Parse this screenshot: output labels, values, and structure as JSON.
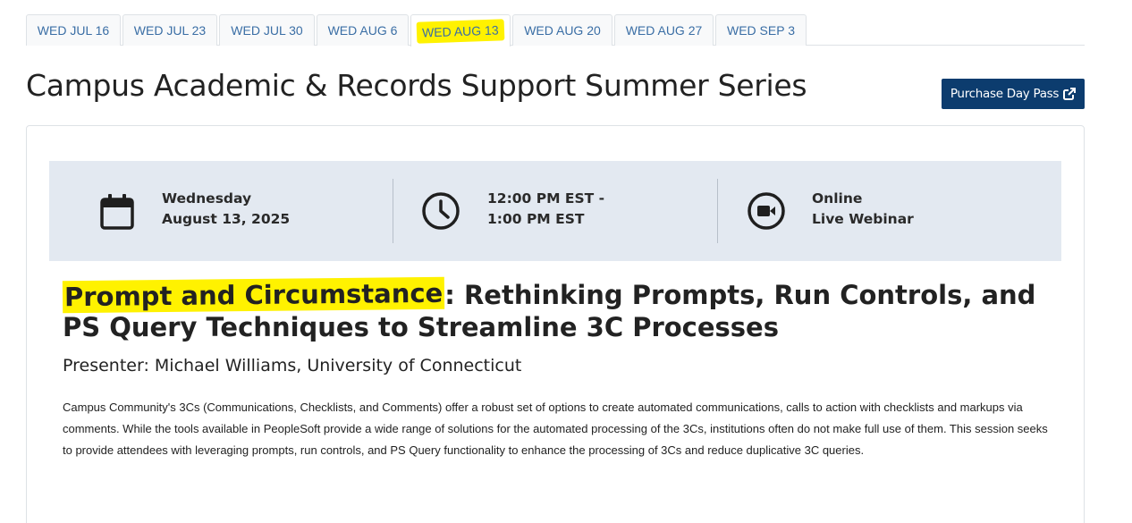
{
  "tabs": [
    {
      "label": "WED JUL 16"
    },
    {
      "label": "WED JUL 23"
    },
    {
      "label": "WED JUL 30"
    },
    {
      "label": "WED AUG 6"
    },
    {
      "label": "WED AUG 13",
      "active": true
    },
    {
      "label": "WED AUG 20"
    },
    {
      "label": "WED AUG 27"
    },
    {
      "label": "WED SEP 3"
    }
  ],
  "page": {
    "title": "Campus Academic & Records Support Summer Series",
    "purchase_label": "Purchase Day Pass",
    "purchase_icon": "external-link-icon"
  },
  "info": {
    "date_line1": "Wednesday",
    "date_line2": "August 13, 2025",
    "time_line1": "12:00 PM EST -",
    "time_line2": "1:00 PM EST",
    "location_line1": "Online",
    "location_line2": "Live Webinar",
    "icons": [
      "calendar-icon",
      "clock-icon",
      "video-camera-icon"
    ]
  },
  "session": {
    "title_highlight": "Prompt and Circumstance",
    "title_rest": ": Rethinking Prompts, Run Controls, and PS Query Techniques to Streamline 3C Processes",
    "presenter": "Presenter: Michael Williams, University of Connecticut",
    "description": "Campus Community's 3Cs (Communications, Checklists, and Comments) offer a robust set of options to create automated communications, calls to action with checklists and markups via comments.  While the tools available in PeopleSoft provide a wide range of solutions for the automated processing of the 3Cs, institutions often do not make full use of them.  This session seeks to provide attendees with leveraging prompts, run controls, and PS Query functionality to enhance the processing of 3Cs and reduce duplicative 3C queries."
  },
  "colors": {
    "highlight": "#fff200",
    "brand_button": "#0c3c6e",
    "tab_text": "#3a6ea5",
    "info_bar": "#e3e9f1"
  }
}
